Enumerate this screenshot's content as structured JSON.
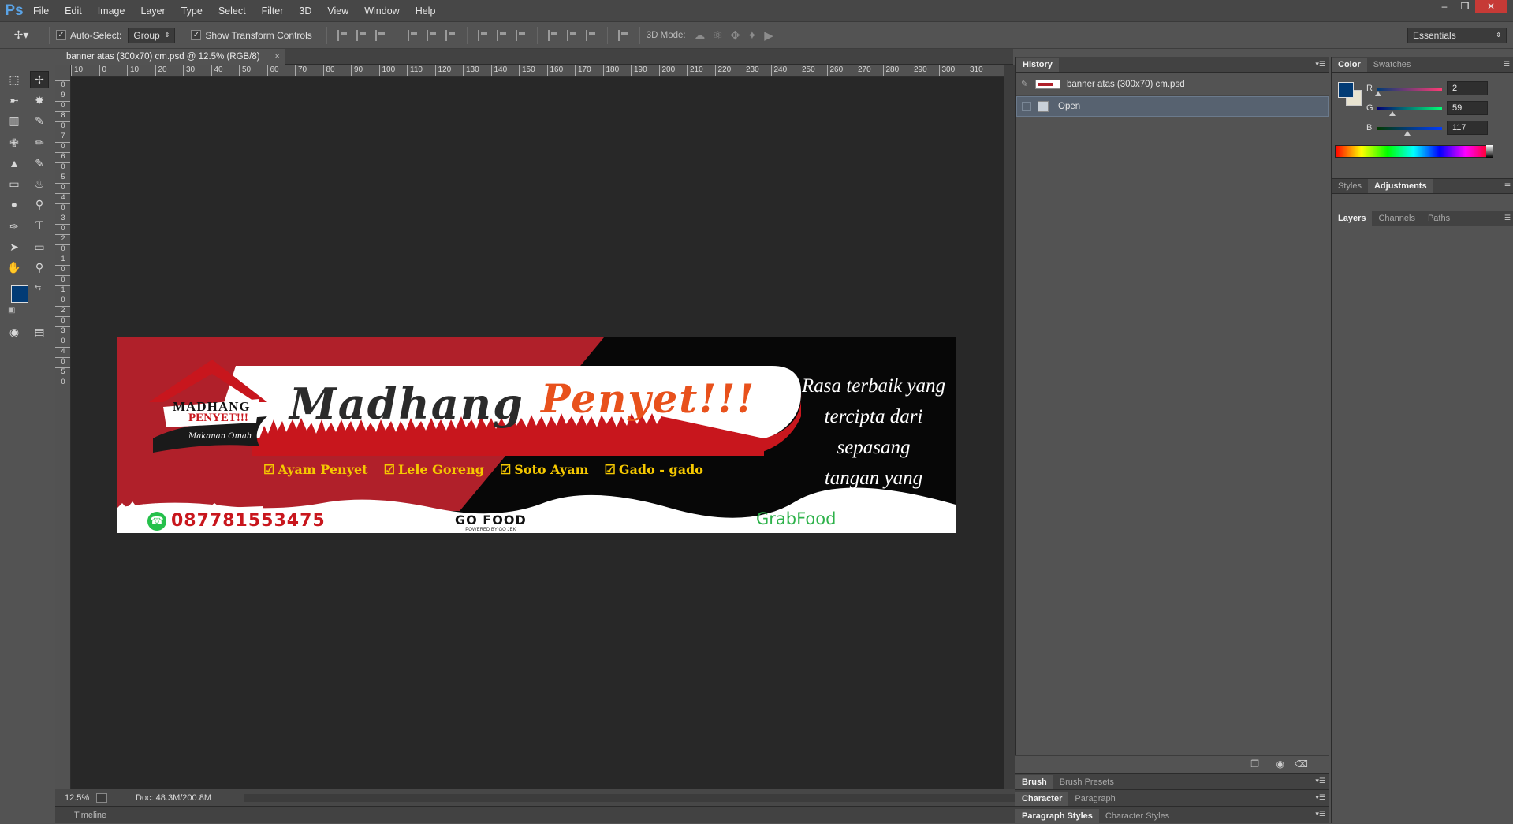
{
  "app": {
    "logo": "Ps"
  },
  "menu": [
    "File",
    "Edit",
    "Image",
    "Layer",
    "Type",
    "Select",
    "Filter",
    "3D",
    "View",
    "Window",
    "Help"
  ],
  "options_bar": {
    "auto_select_label": "Auto-Select:",
    "auto_select_value": "Group",
    "show_transform_label": "Show Transform Controls",
    "mode_3d_label": "3D Mode:",
    "workspace": "Essentials"
  },
  "document": {
    "tab_title": "banner atas (300x70) cm.psd @ 12.5% (RGB/8)",
    "ruler_top": [
      "10",
      "0",
      "10",
      "20",
      "30",
      "40",
      "50",
      "60",
      "70",
      "80",
      "90",
      "100",
      "110",
      "120",
      "130",
      "140",
      "150",
      "160",
      "170",
      "180",
      "190",
      "200",
      "210",
      "220",
      "230",
      "240",
      "250",
      "260",
      "270",
      "280",
      "290",
      "300",
      "310"
    ],
    "ruler_left": [
      "0",
      "9",
      "0",
      "8",
      "0",
      "7",
      "0",
      "6",
      "0",
      "5",
      "0",
      "4",
      "0",
      "3",
      "0",
      "2",
      "0",
      "1",
      "0",
      "0",
      "1",
      "0",
      "2",
      "0",
      "3",
      "0",
      "4",
      "0",
      "5",
      "0"
    ]
  },
  "banner": {
    "logo_text_top": "MADHANG",
    "logo_text_bottom": "PENYET!!!",
    "logo_tagline": "Makanan Omah",
    "title_dark": "Madhang",
    "title_orange": "Penyet!!!",
    "slogan_lines": [
      "Rasa terbaik yang",
      "tercipta dari sepasang",
      "tangan  yang telaten"
    ],
    "menu_items": [
      "Ayam Penyet",
      "Lele Goreng",
      "Soto Ayam",
      "Gado - gado"
    ],
    "phone": "087781553475",
    "gofood": "GO FOOD",
    "gofood_sub": "POWERED BY GO JEK",
    "grabfood": "GrabFood"
  },
  "status": {
    "zoom": "12.5%",
    "doc_size": "Doc: 48.3M/200.8M",
    "timeline": "Timeline"
  },
  "history": {
    "tab": "History",
    "snapshot": "banner atas (300x70) cm.psd",
    "step": "Open"
  },
  "lower_panels": {
    "brush_tabs": [
      "Brush",
      "Brush Presets"
    ],
    "char_tabs": [
      "Character",
      "Paragraph"
    ],
    "style_tabs": [
      "Paragraph Styles",
      "Character Styles"
    ]
  },
  "color_panel": {
    "tabs": [
      "Color",
      "Swatches"
    ],
    "r_label": "R",
    "g_label": "G",
    "b_label": "B",
    "r": "2",
    "g": "59",
    "b": "117",
    "r_level": 0.008,
    "g_level": 0.231,
    "b_level": 0.459,
    "foreground": "#023b75",
    "background": "#e8e3d0"
  },
  "adjust_tabs": [
    "Styles",
    "Adjustments"
  ],
  "layers_tabs": [
    "Layers",
    "Channels",
    "Paths"
  ],
  "colors": {
    "banner_red": "#b0202a",
    "title_orange": "#e8511c",
    "menu_yellow": "#f5c800"
  }
}
